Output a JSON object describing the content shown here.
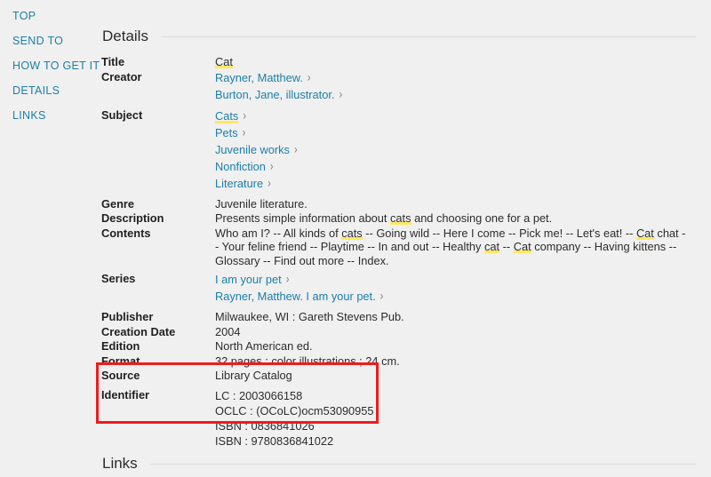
{
  "side_nav": {
    "items": [
      {
        "label": "TOP",
        "name": "sidebar-item-top"
      },
      {
        "label": "SEND TO",
        "name": "sidebar-item-send-to"
      },
      {
        "label": "HOW TO GET IT",
        "name": "sidebar-item-how-to-get-it"
      },
      {
        "label": "DETAILS",
        "name": "sidebar-item-details"
      },
      {
        "label": "LINKS",
        "name": "sidebar-item-links"
      }
    ]
  },
  "sections": {
    "details_title": "Details",
    "links_title": "Links"
  },
  "details": {
    "title": {
      "label": "Title",
      "value": "Cat"
    },
    "creator": {
      "label": "Creator",
      "values": [
        "Rayner, Matthew.",
        "Burton, Jane, illustrator."
      ]
    },
    "subject": {
      "label": "Subject",
      "values": [
        "Cats",
        "Pets",
        "Juvenile works",
        "Nonfiction",
        "Literature"
      ]
    },
    "genre": {
      "label": "Genre",
      "value": "Juvenile literature."
    },
    "description": {
      "label": "Description",
      "pre": "Presents simple information about ",
      "hl": "cats",
      "post": " and choosing one for a pet."
    },
    "contents": {
      "label": "Contents",
      "parts": [
        {
          "t": "Who am I? -- All kinds of ",
          "h": false
        },
        {
          "t": "cats",
          "h": true
        },
        {
          "t": " -- Going wild -- Here I come -- Pick me! -- Let's eat! -- ",
          "h": false
        },
        {
          "t": "Cat",
          "h": true
        },
        {
          "t": " chat -- Your feline friend -- Playtime -- In and out -- Healthy ",
          "h": false
        },
        {
          "t": "cat",
          "h": true
        },
        {
          "t": " -- ",
          "h": false
        },
        {
          "t": "Cat",
          "h": true
        },
        {
          "t": " company -- Having kittens -- Glossary -- Find out more -- Index.",
          "h": false
        }
      ]
    },
    "series": {
      "label": "Series",
      "values": [
        "I am your pet",
        "Rayner, Matthew. I am your pet."
      ]
    },
    "publisher": {
      "label": "Publisher",
      "value": "Milwaukee, WI : Gareth Stevens Pub."
    },
    "creation_date": {
      "label": "Creation Date",
      "value": "2004"
    },
    "edition": {
      "label": "Edition",
      "value": "North American ed."
    },
    "format": {
      "label": "Format",
      "value": "32 pages : color illustrations ; 24 cm."
    },
    "source": {
      "label": "Source",
      "value": "Library Catalog"
    },
    "identifier": {
      "label": "Identifier",
      "values": [
        "LC : 2003066158",
        "OCLC : (OCoLC)ocm53090955",
        "ISBN : 0836841026",
        "ISBN : 9780836841022"
      ]
    }
  },
  "icons": {
    "chevron": "›"
  },
  "colors": {
    "link": "#1b7fa8",
    "highlight": "#ffe95c",
    "annotation_box": "#ee1c1c",
    "background": "#f0f0f0"
  }
}
